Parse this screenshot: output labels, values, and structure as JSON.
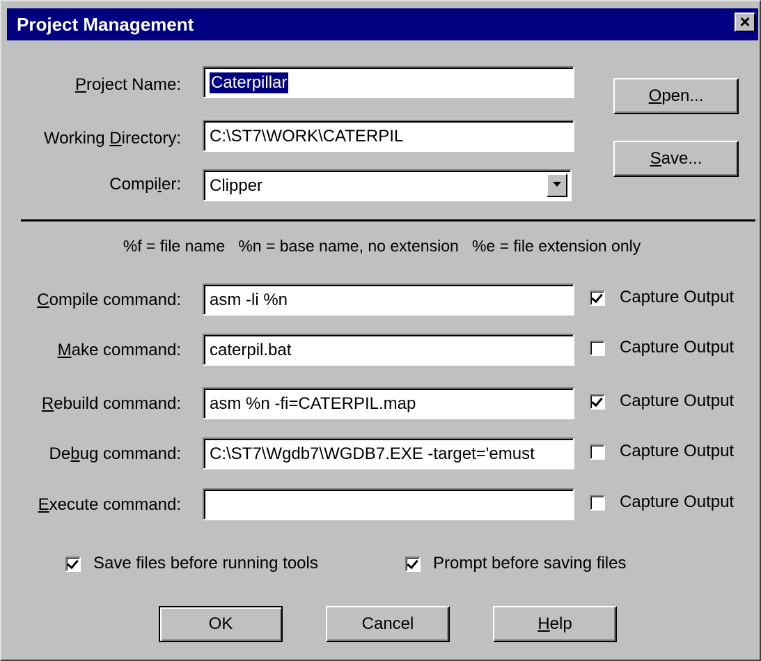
{
  "window": {
    "title": "Project Management",
    "close_label": "×"
  },
  "project": {
    "name_label_pre": "",
    "name_label_u": "P",
    "name_label_post": "roject Name:",
    "name_value": "Caterpillar",
    "dir_label_pre": "Working ",
    "dir_label_u": "D",
    "dir_label_post": "irectory:",
    "dir_value": "C:\\ST7\\WORK\\CATERPIL",
    "compiler_label_pre": "Compi",
    "compiler_label_u": "l",
    "compiler_label_post": "er:",
    "compiler_value": "Clipper"
  },
  "buttons": {
    "open_u": "O",
    "open_rest": "pen...",
    "save_u": "S",
    "save_rest": "ave...",
    "ok": "OK",
    "cancel": "Cancel",
    "help_u": "H",
    "help_rest": "elp"
  },
  "legend": "%f = file name   %n = base name, no extension   %e = file extension only",
  "commands": [
    {
      "label_u": "C",
      "label_rest": "ompile command:",
      "label_pre": "",
      "value": "asm -li %n",
      "capture": true,
      "capture_label": "Capture Output"
    },
    {
      "label_u": "M",
      "label_rest": "ake command:",
      "label_pre": "",
      "value": "caterpil.bat",
      "capture": false,
      "capture_label": "Capture Output"
    },
    {
      "label_u": "R",
      "label_rest": "ebuild command:",
      "label_pre": "",
      "value": "asm %n -fi=CATERPIL.map",
      "capture": true,
      "capture_label": "Capture Output"
    },
    {
      "label_pre": "De",
      "label_u": "b",
      "label_rest": "ug command:",
      "value": "C:\\ST7\\Wgdb7\\WGDB7.EXE -target='emust",
      "capture": false,
      "capture_label": "Capture Output"
    },
    {
      "label_u": "E",
      "label_rest": "xecute command:",
      "label_pre": "",
      "value": "",
      "capture": false,
      "capture_label": "Capture Output"
    }
  ],
  "options": {
    "save_files_label": "Save files before running tools",
    "save_files": true,
    "prompt_label": "Prompt before saving files",
    "prompt": true
  }
}
